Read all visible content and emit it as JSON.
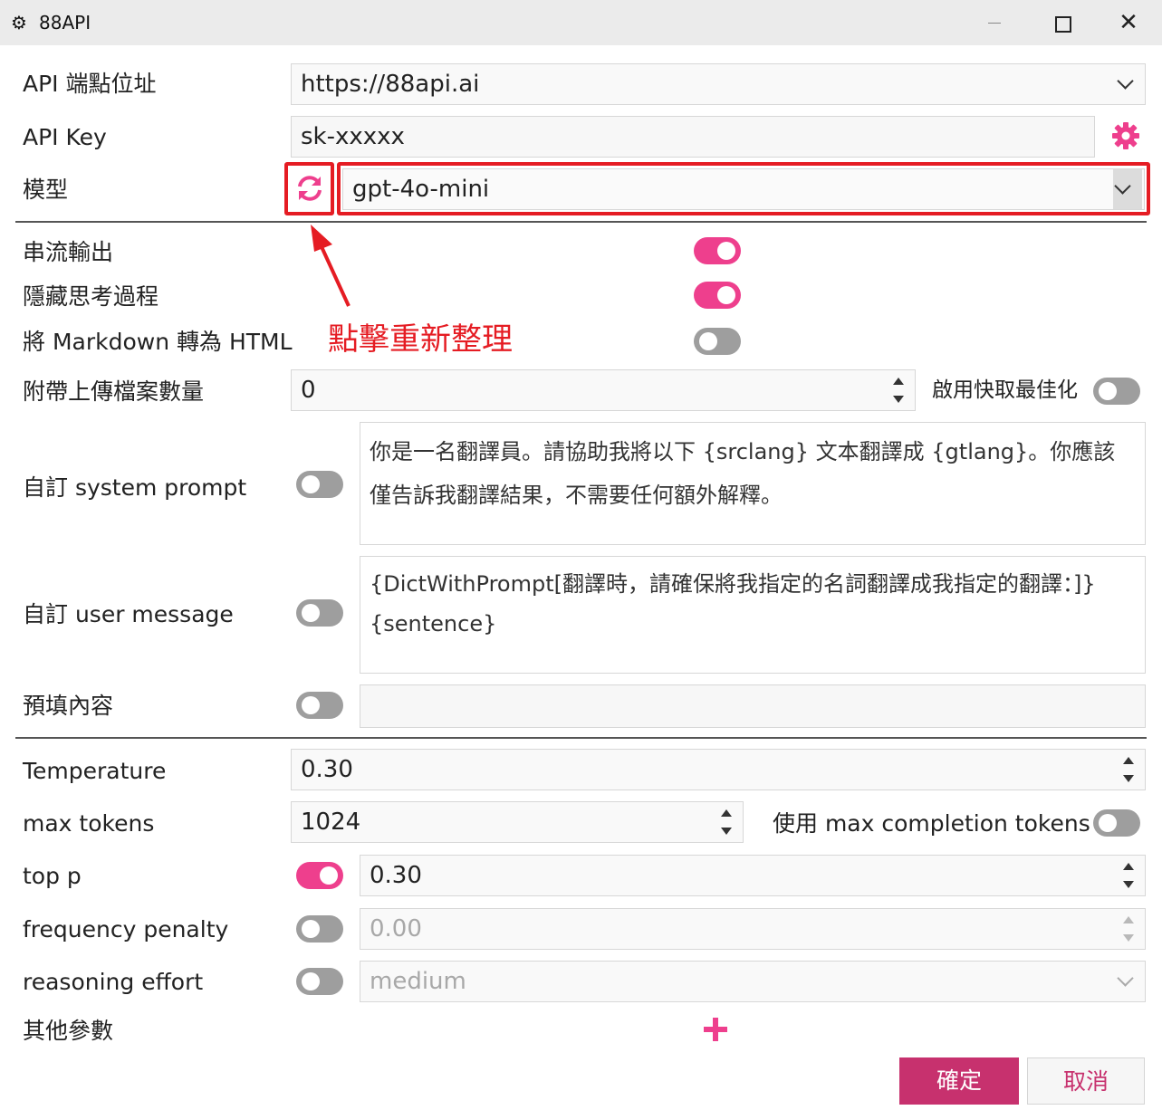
{
  "window": {
    "title": "88API",
    "close_glyph": "✕"
  },
  "fields": {
    "endpoint_label": "API 端點位址",
    "endpoint_value": "https://88api.ai",
    "apikey_label": "API Key",
    "apikey_value": "sk-xxxxx",
    "model_label": "模型",
    "model_value": "gpt-4o-mini",
    "stream_label": "串流輸出",
    "hide_thinking_label": "隱藏思考過程",
    "markdown_label": "將 Markdown 轉為 HTML",
    "attach_label": "附帶上傳檔案數量",
    "attach_value": "0",
    "cache_label": "啟用快取最佳化",
    "system_prompt_label": "自訂 system prompt",
    "system_prompt_value": "你是一名翻譯員。請協助我將以下 {srclang} 文本翻譯成 {gtlang}。你應該僅告訴我翻譯結果，不需要任何額外解釋。",
    "user_message_label": "自訂 user message",
    "user_message_line1": "{DictWithPrompt[翻譯時，請確保將我指定的名詞翻譯成我指定的翻譯：]}",
    "user_message_line2": "{sentence}",
    "prefill_label": "預填內容",
    "prefill_value": "",
    "temperature_label": "Temperature",
    "temperature_value": "0.30",
    "max_tokens_label": "max tokens",
    "max_tokens_value": "1024",
    "max_completion_label": "使用 max completion tokens",
    "top_p_label": "top p",
    "top_p_value": "0.30",
    "frequency_label": "frequency penalty",
    "frequency_value": "0.00",
    "reasoning_label": "reasoning effort",
    "reasoning_value": "medium",
    "other_params_label": "其他參數"
  },
  "toggles": {
    "stream": true,
    "hide_thinking": true,
    "markdown": false,
    "cache": false,
    "system_prompt": false,
    "user_message": false,
    "prefill": false,
    "max_completion": false,
    "top_p": true,
    "frequency": false,
    "reasoning": false
  },
  "annotation": {
    "text": "點擊重新整理"
  },
  "buttons": {
    "ok": "確定",
    "cancel": "取消"
  },
  "colors": {
    "accent": "#ee3f8d",
    "button": "#c7316e",
    "annotation": "#e51c23"
  },
  "icons": {
    "app": "gear-icon",
    "settings": "gear-icon",
    "refresh": "refresh-icon",
    "add": "plus-icon"
  }
}
